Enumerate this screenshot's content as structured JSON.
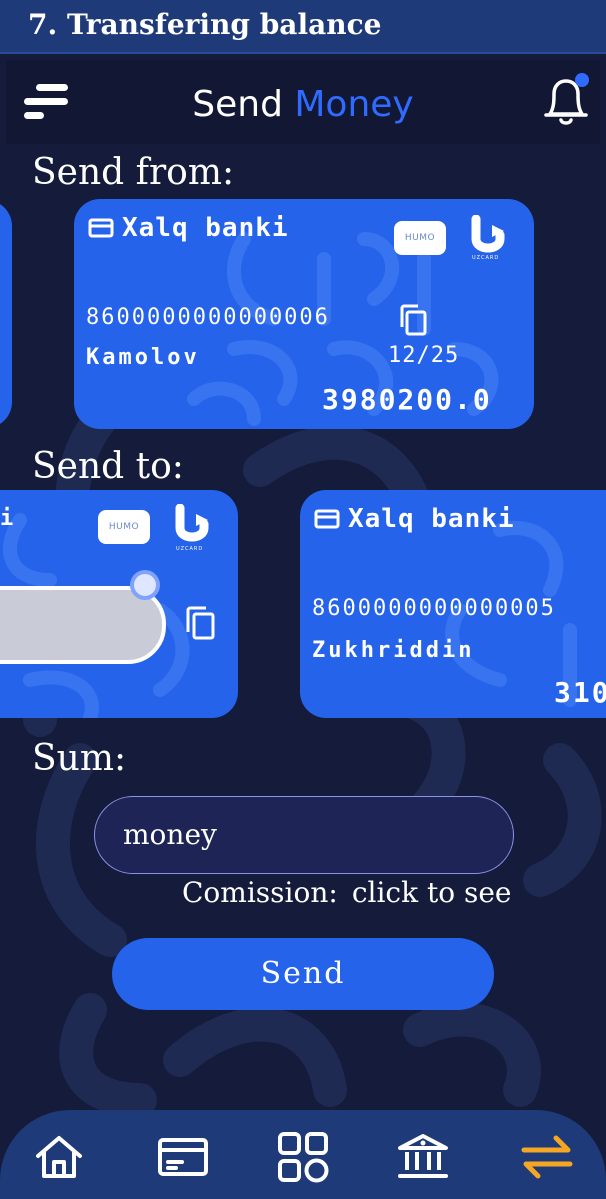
{
  "caption": {
    "title": "7. Transfering balance"
  },
  "header": {
    "title_part1": "Send",
    "title_part2": "Money",
    "menu_icon": "menu-icon",
    "notification_icon": "bell-icon"
  },
  "send_from": {
    "label": "Send from:",
    "card": {
      "bank": "Xalq banki",
      "number": "8600000000000006",
      "holder": "Kamolov",
      "expiry": "12/25",
      "balance": "3980200.0",
      "badge": "HUMO",
      "network": "UZCARD"
    }
  },
  "send_to": {
    "label": "Send to:",
    "left_card": {
      "badge": "HUMO",
      "network": "UZCARD"
    },
    "right_card": {
      "bank": "Xalq banki",
      "number": "8600000000000005",
      "holder": "Zukhriddin",
      "balance_partial": "310"
    }
  },
  "sum": {
    "label": "Sum:",
    "placeholder": "money",
    "commission_label": "Comission:",
    "commission_link": "click to see",
    "send_button": "Send"
  },
  "bottom_nav": {
    "items": [
      "home-icon",
      "card-icon",
      "grid-icon",
      "bank-icon",
      "transfer-icon"
    ],
    "active": "transfer-icon",
    "active_color": "#f5a623"
  },
  "colors": {
    "background": "#141b3b",
    "card": "#2563eb",
    "accent": "#2f6bff",
    "caption_bar": "#1f3a78",
    "notification_dot": "#2f6bff"
  }
}
